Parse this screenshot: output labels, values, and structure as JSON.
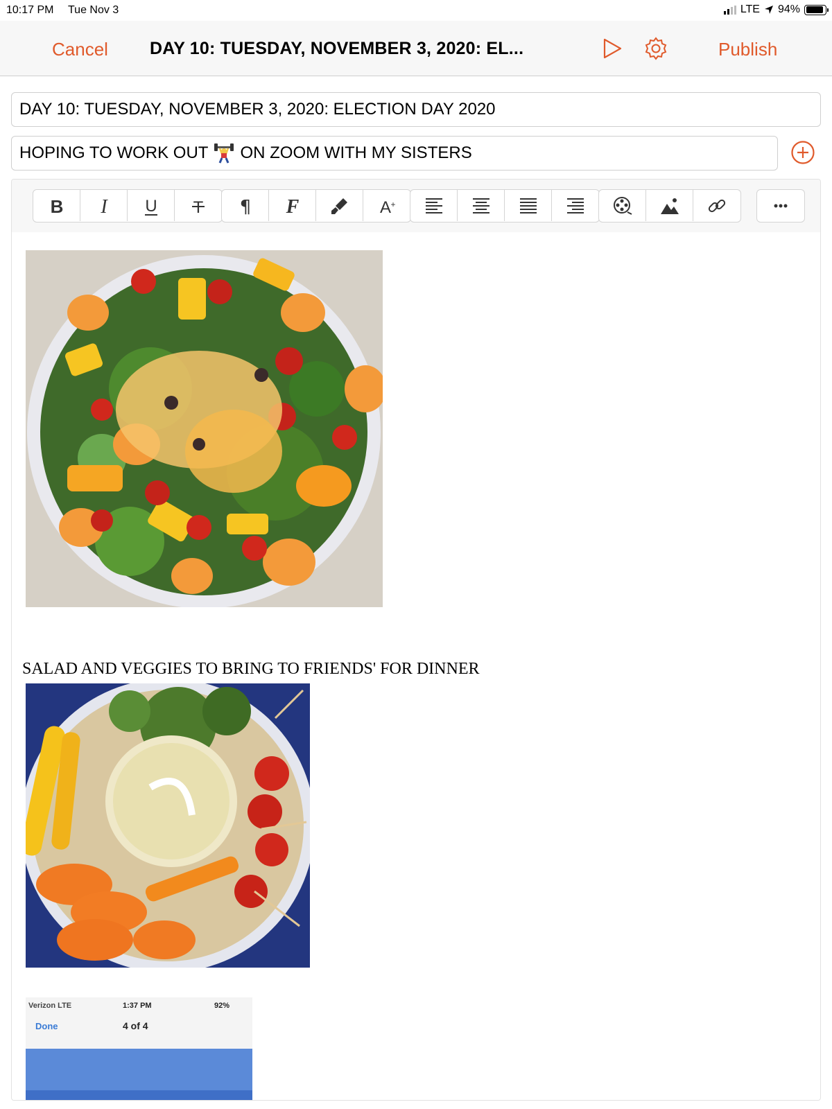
{
  "status_bar": {
    "time": "10:17 PM",
    "date": "Tue Nov 3",
    "network": "LTE",
    "battery": "94%"
  },
  "nav": {
    "cancel_label": "Cancel",
    "title": "DAY 10: TUESDAY, NOVEMBER 3, 2020: EL...",
    "publish_label": "Publish",
    "accent_color": "#e05a2b"
  },
  "post": {
    "title": "DAY 10: TUESDAY, NOVEMBER 3, 2020: ELECTION DAY 2020",
    "subtitle_before": "HOPING TO WORK OUT",
    "subtitle_emoji": "weightlifter-emoji",
    "subtitle_after": "ON ZOOM WITH MY SISTERS"
  },
  "toolbar": {
    "icons": [
      "bold-icon",
      "italic-icon",
      "underline-icon",
      "strikethrough-icon",
      "paragraph-icon",
      "font-icon",
      "brush-icon",
      "text-size-icon",
      "align-left-icon",
      "align-center-icon",
      "align-justify-icon",
      "align-right-icon",
      "film-icon",
      "image-icon",
      "link-icon",
      "more-icon"
    ]
  },
  "body": {
    "caption_1": "SALAD AND VEGGIES TO BRING TO FRIENDS' FOR DINNER",
    "images": [
      "salad-photo",
      "veggie-tray-photo",
      "screenshot-photo"
    ],
    "embedded_screenshot": {
      "carrier": "Verizon LTE",
      "time": "1:37 PM",
      "battery": "92%",
      "done_label": "Done",
      "counter": "4 of 4"
    }
  }
}
